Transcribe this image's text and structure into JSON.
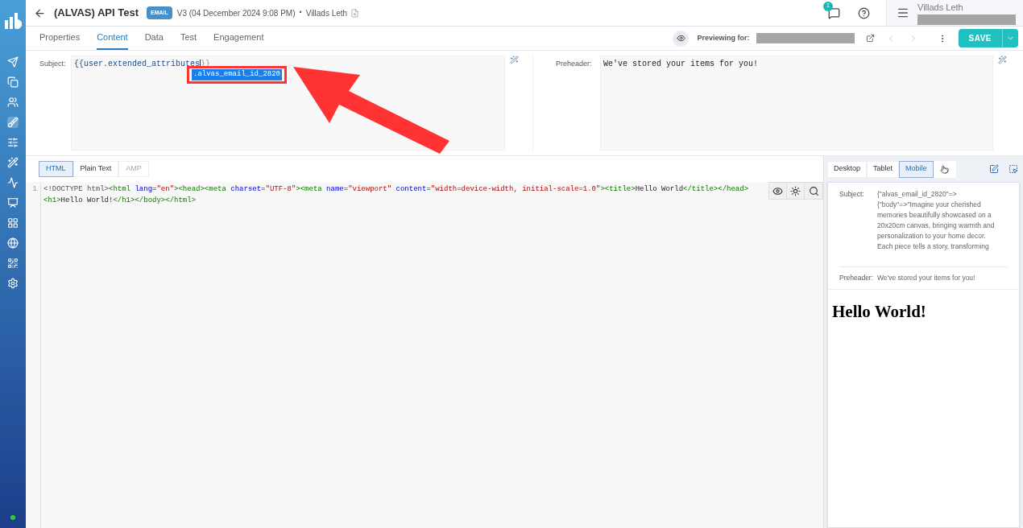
{
  "header": {
    "title": "(ALVAS) API Test",
    "badge": "EMAIL",
    "version": "V3 (04 December 2024 9:08 PM)",
    "separator": "•",
    "author": "Villads Leth",
    "notifications": "1",
    "user_name": "Villads Leth"
  },
  "tabs": [
    {
      "label": "Properties",
      "selected": false
    },
    {
      "label": "Content",
      "selected": true
    },
    {
      "label": "Data",
      "selected": false
    },
    {
      "label": "Test",
      "selected": false
    },
    {
      "label": "Engagement",
      "selected": false
    }
  ],
  "toolbar": {
    "previewing_label": "Previewing for:",
    "save": "SAVE"
  },
  "subject": {
    "label": "Subject:",
    "value": "{{user.extended_attributes",
    "value_end": "}}",
    "suggestion": "alvas_email_id_2820",
    "suggestion_prefix": "."
  },
  "preheader": {
    "label": "Preheader:",
    "value": "We've stored your items for you!"
  },
  "format_tabs": [
    {
      "label": "HTML",
      "selected": true,
      "disabled": false
    },
    {
      "label": "Plain Text",
      "selected": false,
      "disabled": false
    },
    {
      "label": "AMP",
      "selected": false,
      "disabled": true
    }
  ],
  "code": [
    {
      "number": "1",
      "rows": [
        [
          {
            "kind": "meta",
            "text": "<!DOCTYPE html>"
          },
          {
            "kind": "tag",
            "text": "<html"
          },
          {
            "kind": "attr",
            "text": " lang"
          },
          {
            "kind": "plain",
            "text": "="
          },
          {
            "kind": "string",
            "text": "\"en\""
          },
          {
            "kind": "tag",
            "text": "><head><meta"
          },
          {
            "kind": "attr",
            "text": " charset"
          },
          {
            "kind": "plain",
            "text": "="
          },
          {
            "kind": "string",
            "text": "\"UTF-8\""
          },
          {
            "kind": "tag",
            "text": "><meta"
          },
          {
            "kind": "attr",
            "text": " name"
          },
          {
            "kind": "plain",
            "text": "="
          },
          {
            "kind": "string",
            "text": "\"viewport\""
          },
          {
            "kind": "attr",
            "text": " content"
          },
          {
            "kind": "plain",
            "text": "="
          },
          {
            "kind": "string",
            "text": "\"width=device-width, initial-scale=1.0\""
          },
          {
            "kind": "tag",
            "text": "><title>"
          },
          {
            "kind": "plain",
            "text": "Hello World"
          },
          {
            "kind": "tag",
            "text": "</title></head>"
          }
        ],
        [
          {
            "kind": "tag",
            "text": "<h1>"
          },
          {
            "kind": "plain",
            "text": "Hello World!"
          },
          {
            "kind": "tag",
            "text": "</h1></body></html>"
          }
        ]
      ]
    }
  ],
  "device_tabs": [
    {
      "label": "Desktop",
      "selected": false
    },
    {
      "label": "Tablet",
      "selected": false
    },
    {
      "label": "Mobile",
      "selected": true
    }
  ],
  "preview": {
    "subject_label": "Subject:",
    "subject_lines": [
      "{\"alvas_email_id_2820\"=>",
      "{\"body\"=>\"Imagine your cherished",
      "memories beautifully showcased on a",
      "20x20cm canvas, bringing warmth and",
      "personalization to your home decor.",
      "Each piece tells a story, transforming"
    ],
    "preheader_label": "Preheader:",
    "preheader": "We've stored your items for you!",
    "heading": "Hello World!"
  }
}
